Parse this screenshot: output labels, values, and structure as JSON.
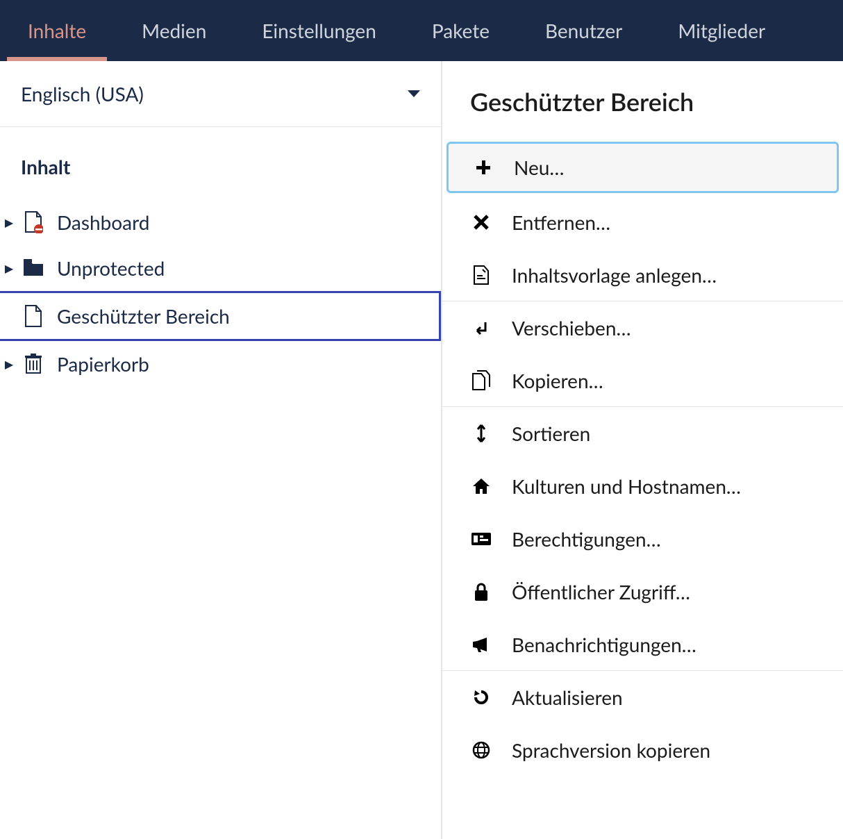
{
  "topnav": {
    "items": [
      {
        "label": "Inhalte",
        "active": true
      },
      {
        "label": "Medien",
        "active": false
      },
      {
        "label": "Einstellungen",
        "active": false
      },
      {
        "label": "Pakete",
        "active": false
      },
      {
        "label": "Benutzer",
        "active": false
      },
      {
        "label": "Mitglieder",
        "active": false
      }
    ]
  },
  "sidebar": {
    "language": "Englisch (USA)",
    "heading": "Inhalt",
    "tree": [
      {
        "label": "Dashboard",
        "icon": "file-forbidden-icon",
        "expandable": true,
        "selected": false
      },
      {
        "label": "Unprotected",
        "icon": "folder-icon",
        "expandable": true,
        "selected": false
      },
      {
        "label": "Geschützter Bereich",
        "icon": "file-icon",
        "expandable": false,
        "selected": true
      },
      {
        "label": "Papierkorb",
        "icon": "trash-icon",
        "expandable": true,
        "selected": false
      }
    ]
  },
  "context": {
    "title": "Geschützter Bereich",
    "items": [
      {
        "label": "Neu…",
        "icon": "plus-icon",
        "focused": true,
        "sep_after": false
      },
      {
        "label": "Entfernen…",
        "icon": "close-icon",
        "focused": false,
        "sep_after": false
      },
      {
        "label": "Inhaltsvorlage anlegen…",
        "icon": "template-icon",
        "focused": false,
        "sep_after": true
      },
      {
        "label": "Verschieben…",
        "icon": "move-icon",
        "focused": false,
        "sep_after": false
      },
      {
        "label": "Kopieren…",
        "icon": "copy-icon",
        "focused": false,
        "sep_after": true
      },
      {
        "label": "Sortieren",
        "icon": "sort-icon",
        "focused": false,
        "sep_after": false
      },
      {
        "label": "Kulturen und Hostnamen…",
        "icon": "home-icon",
        "focused": false,
        "sep_after": false
      },
      {
        "label": "Berechtigungen…",
        "icon": "permissions-icon",
        "focused": false,
        "sep_after": false
      },
      {
        "label": "Öffentlicher Zugriff…",
        "icon": "lock-icon",
        "focused": false,
        "sep_after": false
      },
      {
        "label": "Benachrichtigungen…",
        "icon": "megaphone-icon",
        "focused": false,
        "sep_after": true
      },
      {
        "label": "Aktualisieren",
        "icon": "refresh-icon",
        "focused": false,
        "sep_after": false
      },
      {
        "label": "Sprachversion kopieren",
        "icon": "globe-icon",
        "focused": false,
        "sep_after": false
      }
    ]
  }
}
